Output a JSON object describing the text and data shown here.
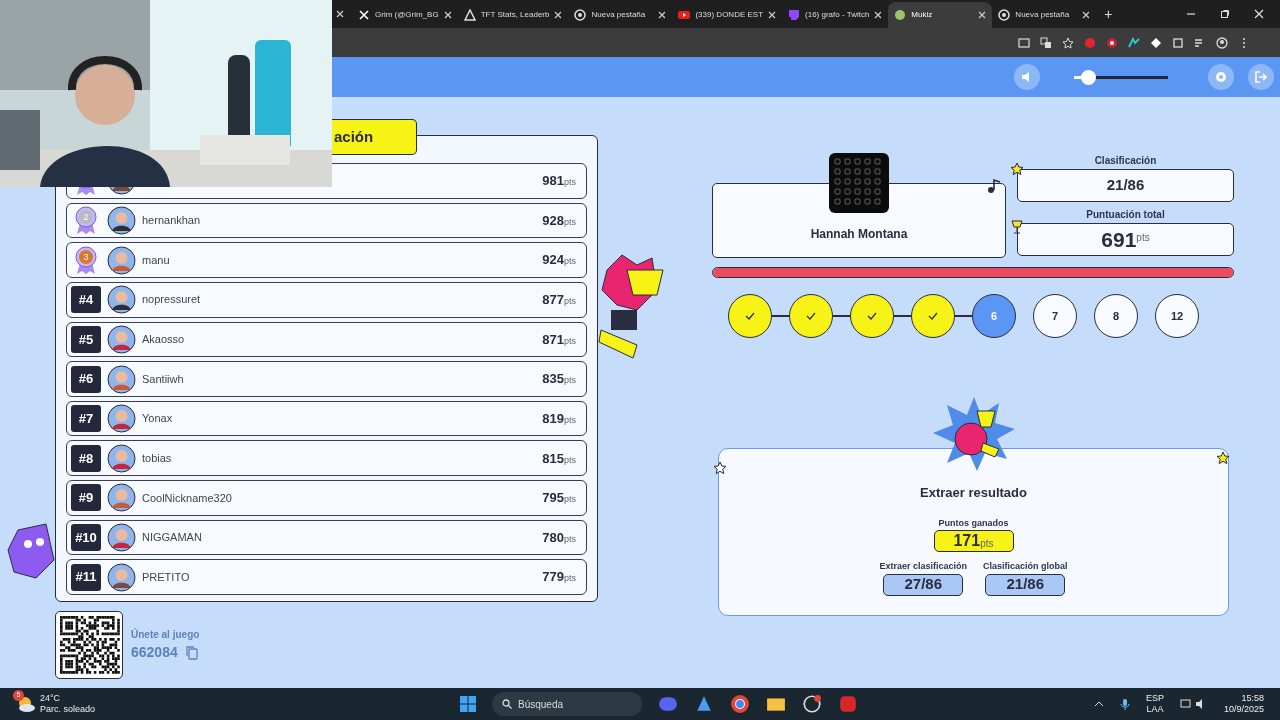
{
  "browser": {
    "tabs": [
      {
        "label": "Grim (@Grim_BG",
        "selected": false,
        "kind": "x"
      },
      {
        "label": "TFT Stats, Leaderb",
        "selected": false,
        "kind": "tft"
      },
      {
        "label": "Nueva pestaña",
        "selected": false,
        "kind": "chrome"
      },
      {
        "label": "(339) DONDE EST",
        "selected": false,
        "kind": "youtube"
      },
      {
        "label": "(16) grafo - Twitch",
        "selected": false,
        "kind": "twitch"
      },
      {
        "label": "Mukiz",
        "selected": true,
        "kind": "app"
      },
      {
        "label": "Nueva pestaña",
        "selected": false,
        "kind": "chrome"
      }
    ],
    "new_tab": "+"
  },
  "game_header": {
    "volume": {
      "level": 0.15
    }
  },
  "leaderboard": {
    "title": "ación",
    "rows": [
      {
        "kind": "medal",
        "rank": "",
        "name": "",
        "score": "981",
        "unit": "pts"
      },
      {
        "kind": "medal",
        "rank": "2",
        "name": "hernankhan",
        "score": "928",
        "unit": "pts"
      },
      {
        "kind": "medal",
        "rank": "3",
        "name": "manu",
        "score": "924",
        "unit": "pts"
      },
      {
        "kind": "number",
        "rank": "#4",
        "name": "nopressuret",
        "score": "877",
        "unit": "pts"
      },
      {
        "kind": "number",
        "rank": "#5",
        "name": "Akaosso",
        "score": "871",
        "unit": "pts"
      },
      {
        "kind": "number",
        "rank": "#6",
        "name": "Santiiwh",
        "score": "835",
        "unit": "pts"
      },
      {
        "kind": "number",
        "rank": "#7",
        "name": "Yonax",
        "score": "819",
        "unit": "pts"
      },
      {
        "kind": "number",
        "rank": "#8",
        "name": "tobias",
        "score": "815",
        "unit": "pts"
      },
      {
        "kind": "number",
        "rank": "#9",
        "name": "CoolNickname320",
        "score": "795",
        "unit": "pts"
      },
      {
        "kind": "number",
        "rank": "#10",
        "name": "NIGGAMAN",
        "score": "780",
        "unit": "pts"
      },
      {
        "kind": "number",
        "rank": "#11",
        "name": "PRETITO",
        "score": "779",
        "unit": "pts"
      }
    ]
  },
  "join": {
    "label": "Únete al juego",
    "code": "662084"
  },
  "player": {
    "name": "Hannah Montana",
    "rank_label": "Clasificación",
    "rank": "21/86",
    "score_label": "Puntuación total",
    "score": "691",
    "score_unit": "pts",
    "timer": {
      "level": 1
    }
  },
  "steps": [
    {
      "done": true,
      "current": false
    },
    {
      "done": true,
      "current": false
    },
    {
      "done": true,
      "current": false
    },
    {
      "done": true,
      "current": false
    },
    {
      "done": false,
      "current": true,
      "label": "6"
    },
    {
      "done": false,
      "current": false,
      "label": "7"
    },
    {
      "done": false,
      "current": false,
      "label": "8"
    },
    {
      "done": false,
      "current": false,
      "label": "12"
    }
  ],
  "result": {
    "title": "Extraer resultado",
    "points_label": "Puntos ganados",
    "points": "171",
    "points_unit": "pts",
    "stats": [
      {
        "label": "Extraer clasificación",
        "value": "27/86"
      },
      {
        "label": "Clasificación global",
        "value": "21/86"
      }
    ]
  },
  "taskbar": {
    "weather_badge": "5",
    "temperature": "24°C",
    "weather": "Parc. soleado",
    "search": "Búsqueda",
    "lang": "ESP",
    "layout": "LAA",
    "time": "15:58",
    "date": "10/9/2025"
  }
}
